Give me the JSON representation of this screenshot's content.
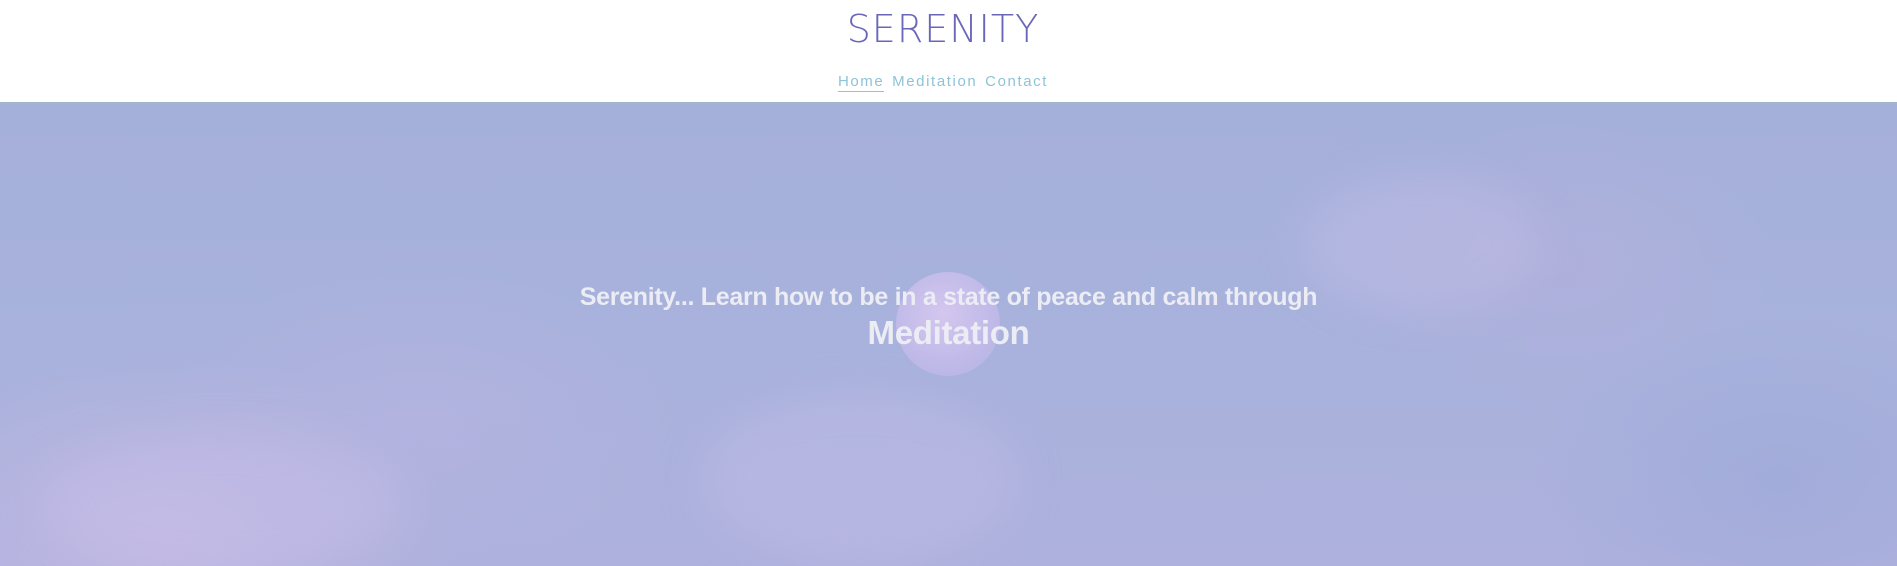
{
  "header": {
    "brand": "SERENITY",
    "nav": [
      {
        "label": "Home",
        "active": true
      },
      {
        "label": "Meditation",
        "active": false
      },
      {
        "label": "Contact",
        "active": false
      }
    ]
  },
  "hero": {
    "headline": "Serenity... Learn how to be in a state of peace and calm through",
    "subheadline": "Meditation"
  },
  "colors": {
    "brand": "#6a66b8",
    "nav_link": "#8ec3d8",
    "hero_sky": "#a5b0da",
    "hero_text": "#ececf4"
  }
}
